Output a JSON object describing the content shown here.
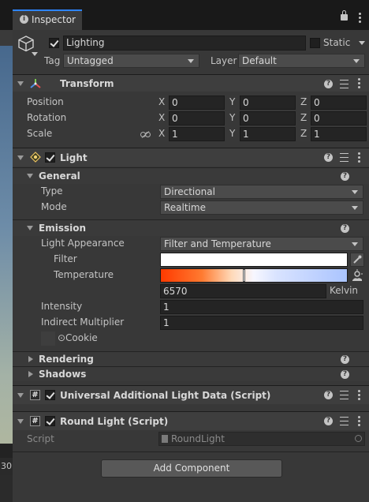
{
  "tab": {
    "label": "Inspector"
  },
  "object": {
    "name": "Lighting",
    "static_label": "Static",
    "tag_label": "Tag",
    "tag_value": "Untagged",
    "layer_label": "Layer",
    "layer_value": "Default"
  },
  "transform": {
    "title": "Transform",
    "rows": [
      {
        "label": "Position",
        "x": "0",
        "y": "0",
        "z": "0"
      },
      {
        "label": "Rotation",
        "x": "0",
        "y": "0",
        "z": "0"
      },
      {
        "label": "Scale",
        "x": "1",
        "y": "1",
        "z": "1"
      }
    ],
    "axis": {
      "x": "X",
      "y": "Y",
      "z": "Z"
    }
  },
  "light": {
    "title": "Light",
    "general": {
      "title": "General",
      "type_label": "Type",
      "type_value": "Directional",
      "mode_label": "Mode",
      "mode_value": "Realtime"
    },
    "emission": {
      "title": "Emission",
      "appearance_label": "Light Appearance",
      "appearance_value": "Filter and Temperature",
      "filter_label": "Filter",
      "temperature_label": "Temperature",
      "temperature_value": "6570",
      "temperature_unit": "Kelvin",
      "intensity_label": "Intensity",
      "intensity_value": "1",
      "indirect_label": "Indirect Multiplier",
      "indirect_value": "1",
      "cookie_label": "⊙Cookie"
    },
    "rendering_title": "Rendering",
    "shadows_title": "Shadows"
  },
  "uald": {
    "title": "Universal Additional Light Data (Script)"
  },
  "round_light": {
    "title": "Round Light (Script)",
    "script_label": "Script",
    "script_value": "RoundLight"
  },
  "add_component": {
    "label": "Add Component"
  },
  "scene_strip": {
    "bottom_text": "30"
  },
  "colors": {
    "accent": "#2d84ff",
    "panel": "#383838",
    "header": "#3e3e3e",
    "temp_cold": "#aac4ff",
    "temp_warm": "#ff3a00"
  }
}
